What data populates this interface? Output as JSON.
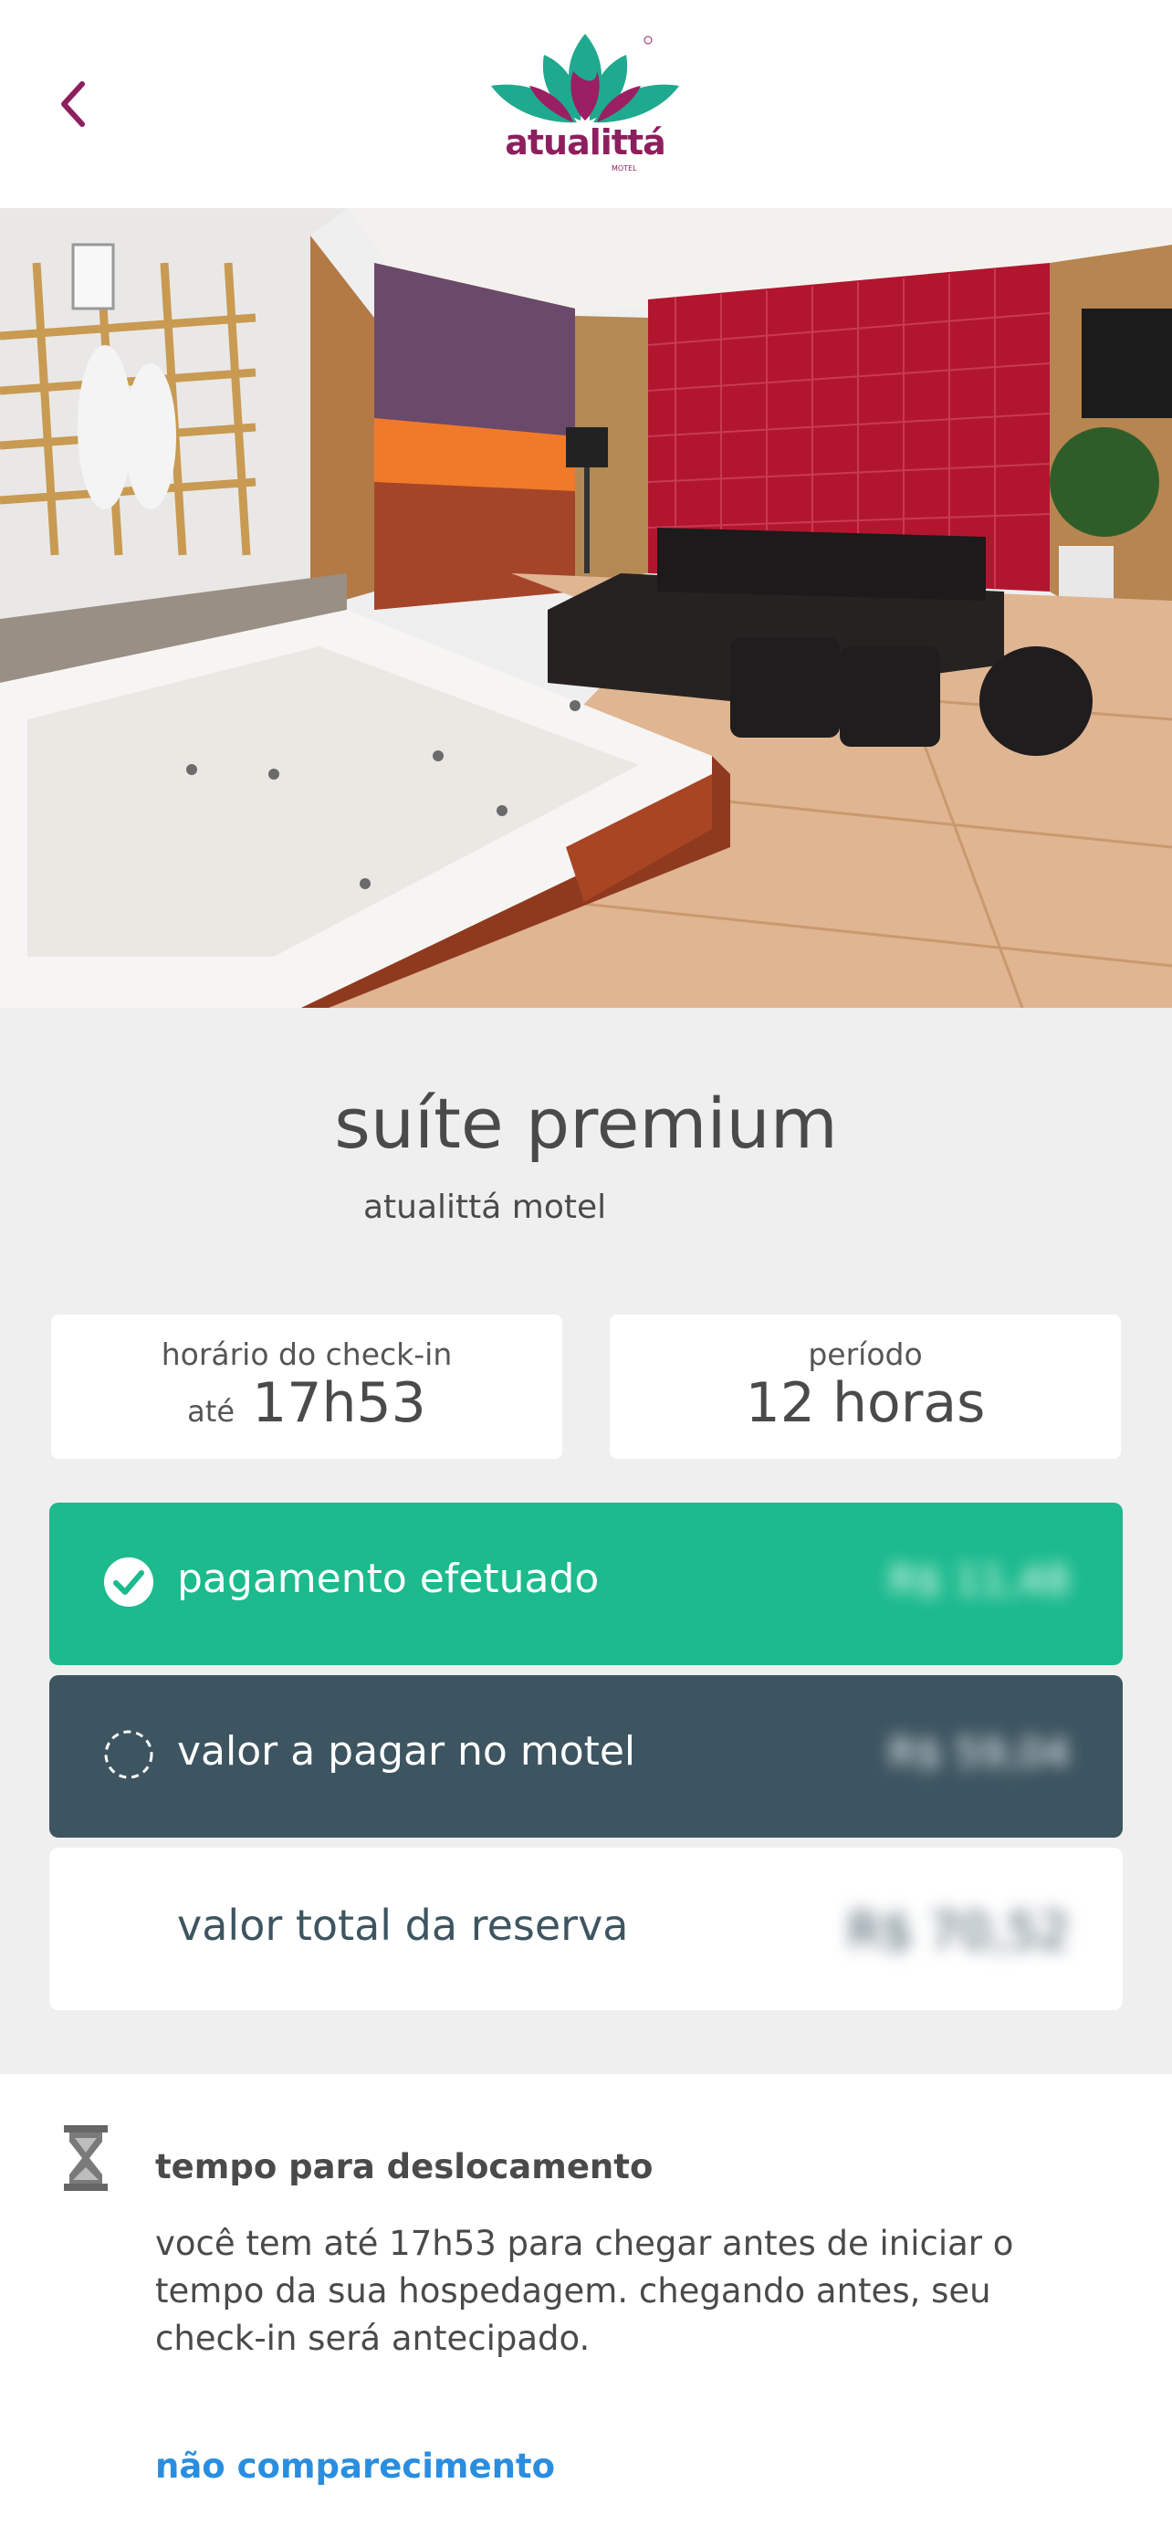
{
  "header": {
    "back_icon": "chevron-left-icon",
    "logo_text": "atualittá",
    "logo_sub": "MOTEL",
    "accent": "#8e1f5e",
    "logo_teal": "#1fa98f"
  },
  "hero": {
    "image": "suite-photo-hot-tub-lounge"
  },
  "suite": {
    "title": "suíte premium",
    "subtitle": "atualittá motel"
  },
  "checkin": {
    "label": "horário do check-in",
    "prefix": "até",
    "value": "17h53"
  },
  "period": {
    "label": "período",
    "value": "12 horas"
  },
  "payments": {
    "paid": {
      "label": "pagamento efetuado",
      "value": "R$ 11,48",
      "icon": "check-circle-icon",
      "color": "#1cba8d"
    },
    "to_pay": {
      "label": "valor a pagar no motel",
      "value": "R$ 59,04",
      "icon": "dashed-circle-icon",
      "color": "#3d5561"
    },
    "total": {
      "label": "valor total da reserva",
      "value": "R$ 70,52"
    }
  },
  "travel": {
    "icon": "hourglass-icon",
    "title": "tempo para deslocamento",
    "text": "você tem até 17h53 para chegar antes de iniciar o tempo da sua hospedagem. chegando antes, seu check-in será antecipado.",
    "link": "não comparecimento"
  }
}
